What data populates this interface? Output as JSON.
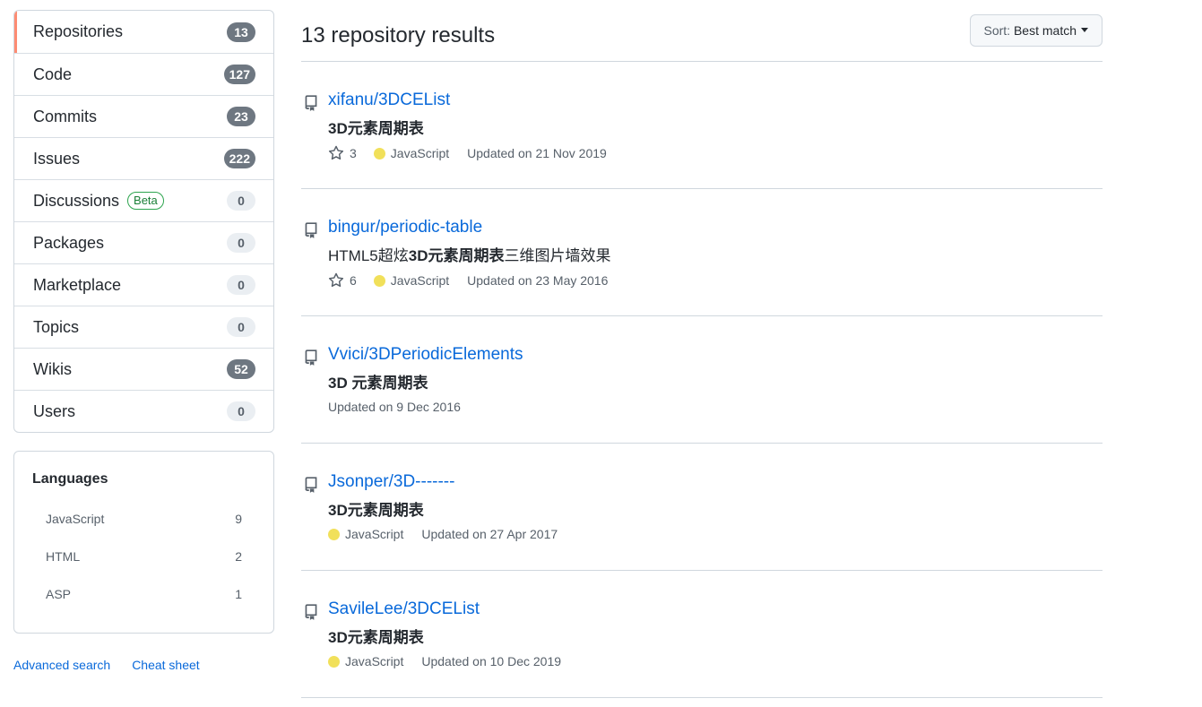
{
  "sidebar": {
    "items": [
      {
        "label": "Repositories",
        "count": "13",
        "style": "dark",
        "selected": true
      },
      {
        "label": "Code",
        "count": "127",
        "style": "dark"
      },
      {
        "label": "Commits",
        "count": "23",
        "style": "dark"
      },
      {
        "label": "Issues",
        "count": "222",
        "style": "dark"
      },
      {
        "label": "Discussions",
        "count": "0",
        "style": "light",
        "badge": "Beta"
      },
      {
        "label": "Packages",
        "count": "0",
        "style": "light"
      },
      {
        "label": "Marketplace",
        "count": "0",
        "style": "light"
      },
      {
        "label": "Topics",
        "count": "0",
        "style": "light"
      },
      {
        "label": "Wikis",
        "count": "52",
        "style": "dark"
      },
      {
        "label": "Users",
        "count": "0",
        "style": "light"
      }
    ],
    "languages": {
      "title": "Languages",
      "items": [
        {
          "name": "JavaScript",
          "count": "9"
        },
        {
          "name": "HTML",
          "count": "2"
        },
        {
          "name": "ASP",
          "count": "1"
        }
      ]
    },
    "links": {
      "advanced": "Advanced search",
      "cheat": "Cheat sheet"
    }
  },
  "main": {
    "title": "13 repository results",
    "sort": {
      "key": "Sort:",
      "value": "Best match"
    },
    "repos": [
      {
        "name": "xifanu/3DCEList",
        "desc_pre": "",
        "desc_bold": "3D元素周期表",
        "desc_post": "",
        "stars": "3",
        "language": "JavaScript",
        "updated": "Updated on 21 Nov 2019"
      },
      {
        "name": "bingur/periodic-table",
        "desc_pre": "HTML5超炫",
        "desc_bold": "3D元素周期表",
        "desc_post": "三维图片墙效果",
        "stars": "6",
        "language": "JavaScript",
        "updated": "Updated on 23 May 2016"
      },
      {
        "name": "Vvici/3DPeriodicElements",
        "desc_pre": "",
        "desc_bold": "3D 元素周期表",
        "desc_post": "",
        "stars": "",
        "language": "",
        "updated": "Updated on 9 Dec 2016"
      },
      {
        "name": "Jsonper/3D-------",
        "desc_pre": "",
        "desc_bold": "3D元素周期表",
        "desc_post": "",
        "stars": "",
        "language": "JavaScript",
        "updated": "Updated on 27 Apr 2017"
      },
      {
        "name": "SavileLee/3DCEList",
        "desc_pre": "",
        "desc_bold": "3D元素周期表",
        "desc_post": "",
        "stars": "",
        "language": "JavaScript",
        "updated": "Updated on 10 Dec 2019"
      }
    ]
  },
  "colors": {
    "link": "#0969da",
    "selected_bar": "#fd8c73",
    "javascript": "#f1e05a"
  }
}
